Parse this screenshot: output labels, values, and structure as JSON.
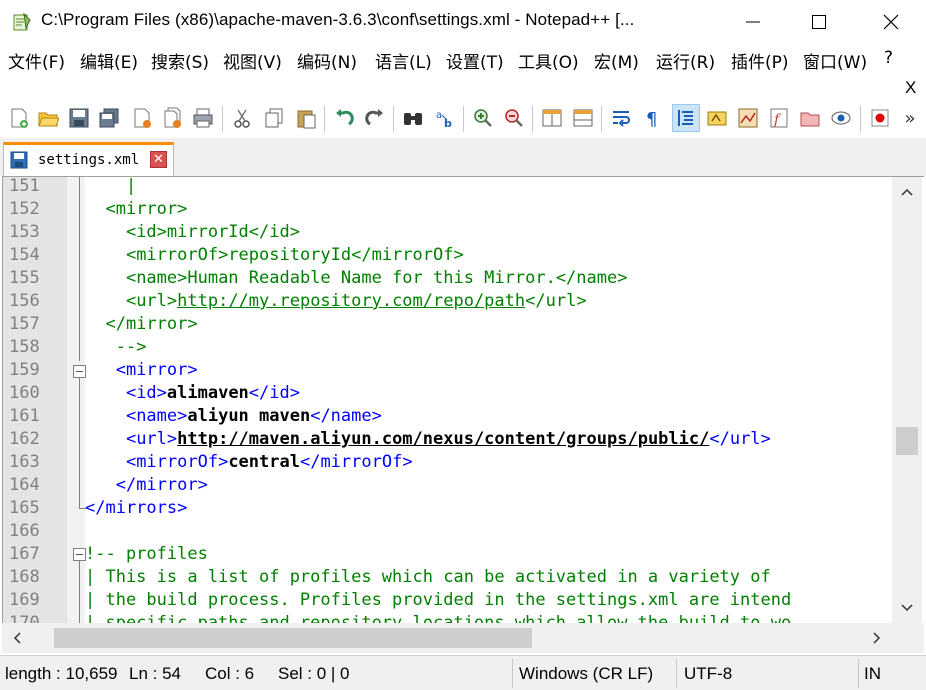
{
  "window": {
    "title": "C:\\Program Files (x86)\\apache-maven-3.6.3\\conf\\settings.xml - Notepad++ [...",
    "minimize_icon": "minimize-icon",
    "maximize_icon": "maximize-icon",
    "close_icon": "close-icon"
  },
  "menu": {
    "items": [
      "文件(F)",
      "编辑(E)",
      "搜索(S)",
      "视图(V)",
      "编码(N)",
      "语言(L)",
      "设置(T)",
      "工具(O)",
      "宏(M)",
      "运行(R)",
      "插件(P)",
      "窗口(W)",
      "?"
    ],
    "close_doc": "X"
  },
  "toolbar": {
    "icons": [
      "new-file-icon",
      "open-file-icon",
      "save-icon",
      "save-all-icon",
      "close-icon",
      "close-all-icon",
      "print-icon",
      "cut-icon",
      "copy-icon",
      "paste-icon",
      "undo-icon",
      "redo-icon",
      "find-icon",
      "replace-icon",
      "zoom-in-icon",
      "zoom-out-icon",
      "sync-vertical-icon",
      "sync-horizontal-icon",
      "word-wrap-icon",
      "show-all-chars-icon",
      "indent-guide-icon",
      "udl-icon",
      "doc-map-icon",
      "function-list-icon",
      "folder-workspace-icon",
      "monitoring-icon",
      "record-macro-icon"
    ],
    "overflow": "»"
  },
  "tab": {
    "label": "settings.xml",
    "close": "✕"
  },
  "editor": {
    "lines": [
      {
        "num": "151",
        "segments": [
          {
            "t": "    |",
            "c": "comment"
          }
        ]
      },
      {
        "num": "152",
        "segments": [
          {
            "t": "  ",
            "c": ""
          },
          {
            "t": "<mirror>",
            "c": "comment"
          }
        ]
      },
      {
        "num": "153",
        "segments": [
          {
            "t": "    ",
            "c": ""
          },
          {
            "t": "<id>mirrorId</id>",
            "c": "comment"
          }
        ]
      },
      {
        "num": "154",
        "segments": [
          {
            "t": "    ",
            "c": ""
          },
          {
            "t": "<mirrorOf>repositoryId</mirrorOf>",
            "c": "comment"
          }
        ]
      },
      {
        "num": "155",
        "segments": [
          {
            "t": "    ",
            "c": ""
          },
          {
            "t": "<name>Human Readable Name for this Mirror.</name>",
            "c": "comment"
          }
        ]
      },
      {
        "num": "156",
        "segments": [
          {
            "t": "    ",
            "c": ""
          },
          {
            "t": "<url>",
            "c": "comment"
          },
          {
            "t": "http://my.repository.com/repo/path",
            "c": "comment url"
          },
          {
            "t": "</url>",
            "c": "comment"
          }
        ]
      },
      {
        "num": "157",
        "segments": [
          {
            "t": "  ",
            "c": ""
          },
          {
            "t": "</mirror>",
            "c": "comment"
          }
        ]
      },
      {
        "num": "158",
        "segments": [
          {
            "t": "   ",
            "c": ""
          },
          {
            "t": "-->",
            "c": "comment"
          }
        ]
      },
      {
        "num": "159",
        "segments": [
          {
            "t": "   ",
            "c": ""
          },
          {
            "t": "<mirror>",
            "c": "tag"
          }
        ]
      },
      {
        "num": "160",
        "segments": [
          {
            "t": "    ",
            "c": ""
          },
          {
            "t": "<id>",
            "c": "tag"
          },
          {
            "t": "alimaven",
            "c": "bold"
          },
          {
            "t": "</id>",
            "c": "tag"
          }
        ]
      },
      {
        "num": "161",
        "segments": [
          {
            "t": "    ",
            "c": ""
          },
          {
            "t": "<name>",
            "c": "tag"
          },
          {
            "t": "aliyun maven",
            "c": "bold"
          },
          {
            "t": "</name>",
            "c": "tag"
          }
        ]
      },
      {
        "num": "162",
        "segments": [
          {
            "t": "    ",
            "c": ""
          },
          {
            "t": "<url>",
            "c": "tag"
          },
          {
            "t": "http://maven.aliyun.com/nexus/content/groups/public/",
            "c": "bold url"
          },
          {
            "t": "</url>",
            "c": "tag"
          }
        ]
      },
      {
        "num": "163",
        "segments": [
          {
            "t": "    ",
            "c": ""
          },
          {
            "t": "<mirrorOf>",
            "c": "tag"
          },
          {
            "t": "central",
            "c": "bold"
          },
          {
            "t": "</mirrorOf>",
            "c": "tag"
          }
        ]
      },
      {
        "num": "164",
        "segments": [
          {
            "t": "   ",
            "c": ""
          },
          {
            "t": "</mirror>",
            "c": "tag"
          }
        ]
      },
      {
        "num": "165",
        "segments": [
          {
            "t": "</mirrors>",
            "c": "tag"
          }
        ]
      },
      {
        "num": "166",
        "segments": [
          {
            "t": "",
            "c": ""
          }
        ]
      },
      {
        "num": "167",
        "segments": [
          {
            "t": "!-- profiles",
            "c": "comment"
          }
        ]
      },
      {
        "num": "168",
        "segments": [
          {
            "t": "| This is a list of profiles which can be activated in a variety of",
            "c": "comment"
          }
        ]
      },
      {
        "num": "169",
        "segments": [
          {
            "t": "| the build process. Profiles provided in the settings.xml are intend",
            "c": "comment"
          }
        ]
      },
      {
        "num": "170",
        "segments": [
          {
            "t": "| specific paths and repository locations which allow the build to wo",
            "c": "comment"
          }
        ]
      }
    ]
  },
  "statusbar": {
    "length": "length : 10,659",
    "ln": "Ln : 54",
    "col": "Col : 6",
    "sel": "Sel : 0 | 0",
    "eol": "Windows (CR LF)",
    "encoding": "UTF-8",
    "mode": "INS"
  },
  "colors": {
    "tag": "#0000ff",
    "comment": "#008000",
    "line_number": "#808080",
    "tab_accent": "#fa8c0c"
  }
}
